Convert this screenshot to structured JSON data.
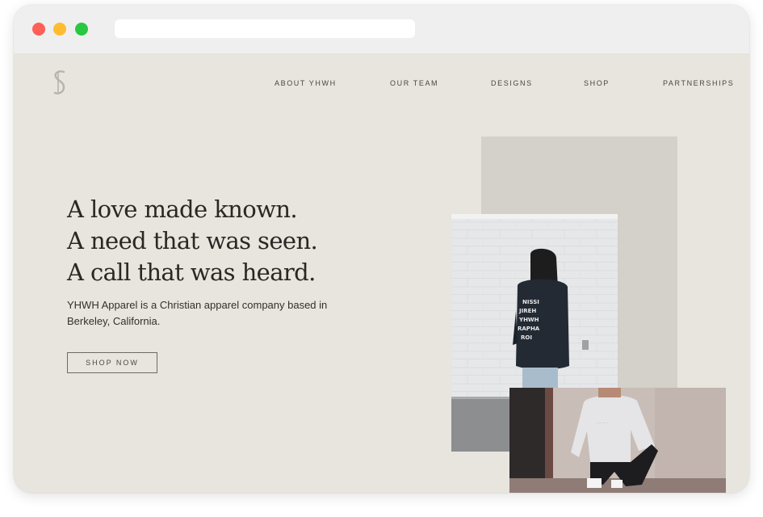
{
  "browser": {
    "controls": [
      "close",
      "minimize",
      "maximize"
    ],
    "url": ""
  },
  "nav": {
    "logo_icon": "yhwh-monogram-logo",
    "items": [
      {
        "label": "ABOUT YHWH"
      },
      {
        "label": "OUR TEAM"
      },
      {
        "label": "DESIGNS"
      },
      {
        "label": "SHOP"
      },
      {
        "label": "PARTNERSHIPS"
      }
    ]
  },
  "hero": {
    "headline": [
      "A love made known.",
      "A need that was seen.",
      "A call that was heard."
    ],
    "description": "YHWH Apparel is a Christian apparel company based in Berkeley, California.",
    "cta_label": "SHOP NOW",
    "hoodie_print": [
      "NISSI",
      "JIREH",
      "YHWH",
      "RAPHA",
      "ROI"
    ]
  },
  "colors": {
    "page_background": "#e8e4de",
    "accent_block": "#d4d0ca",
    "text_primary": "#2a2724",
    "titlebar": "#f0efef"
  }
}
